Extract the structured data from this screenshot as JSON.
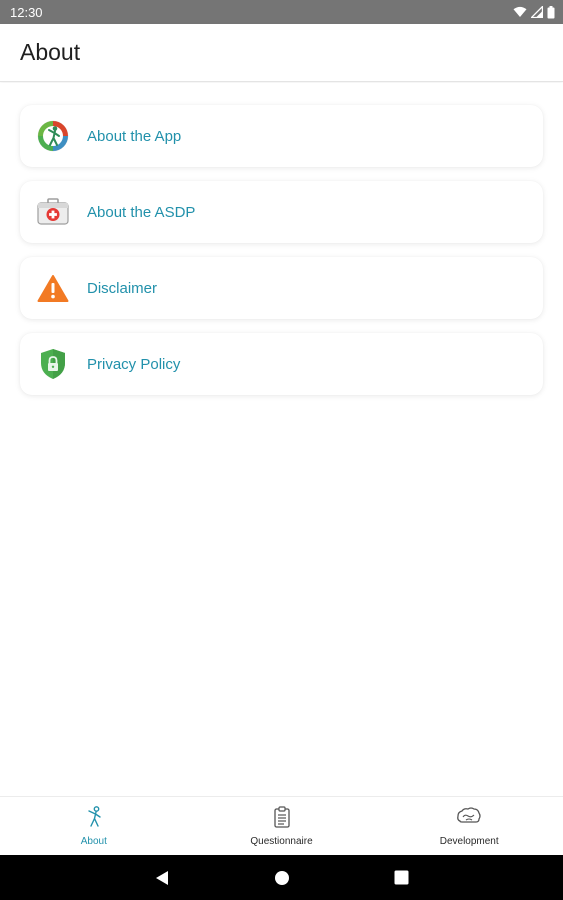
{
  "status_bar": {
    "time": "12:30",
    "icons": [
      "wifi-icon",
      "signal-icon",
      "battery-icon"
    ]
  },
  "app_bar": {
    "title": "About"
  },
  "menu": {
    "items": [
      {
        "label": "About the App",
        "icon": "app-logo-icon"
      },
      {
        "label": "About the ASDP",
        "icon": "first-aid-kit-icon"
      },
      {
        "label": "Disclaimer",
        "icon": "warning-icon"
      },
      {
        "label": "Privacy Policy",
        "icon": "shield-lock-icon"
      }
    ]
  },
  "bottom_nav": {
    "items": [
      {
        "label": "About",
        "icon": "child-figure-icon",
        "active": true
      },
      {
        "label": "Questionnaire",
        "icon": "clipboard-icon",
        "active": false
      },
      {
        "label": "Development",
        "icon": "brain-icon",
        "active": false
      }
    ]
  },
  "system_nav": {
    "buttons": [
      "back-icon",
      "home-icon",
      "recents-icon"
    ]
  },
  "colors": {
    "accent": "#2291ab",
    "status_bar": "#757575",
    "warning": "#f27a24",
    "shield": "#4caf50"
  }
}
